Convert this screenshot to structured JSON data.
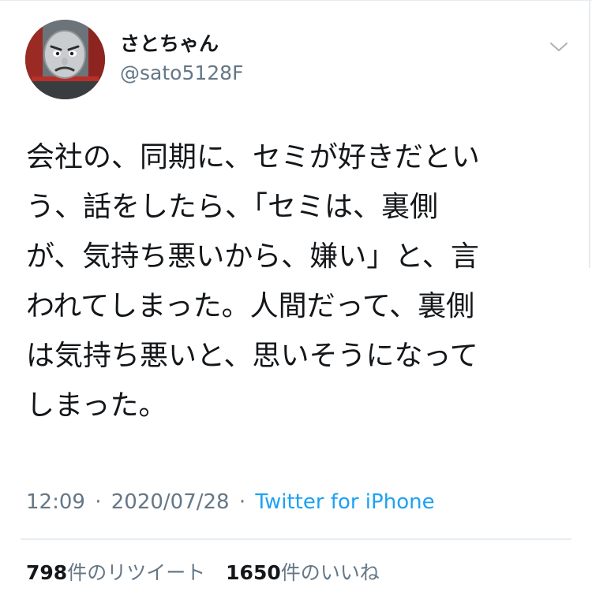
{
  "header": {
    "display_name": "さとちゃん",
    "handle": "@sato5128F"
  },
  "tweet": {
    "lines": [
      "会社の、同期に、セミが好きだとい",
      "う、話をしたら、「セミは、裏側",
      "が、気持ち悪いから、嫌い」と、言",
      "われてしまった。人間だって、裏側",
      "は気持ち悪いと、思いそうになって",
      "しまった。"
    ]
  },
  "meta": {
    "time": "12:09",
    "separator": "·",
    "date": "2020/07/28",
    "source": "Twitter for iPhone"
  },
  "stats": {
    "retweets_count": "798",
    "retweets_label": "件のリツイート",
    "likes_count": "1650",
    "likes_label": "件のいいね"
  },
  "colors": {
    "text": "#14171a",
    "secondary": "#657786",
    "link": "#1da1f2",
    "divider": "#e6ecf0"
  },
  "icons": {
    "avatar": "train-face-avatar",
    "menu": "chevron-down-icon"
  }
}
